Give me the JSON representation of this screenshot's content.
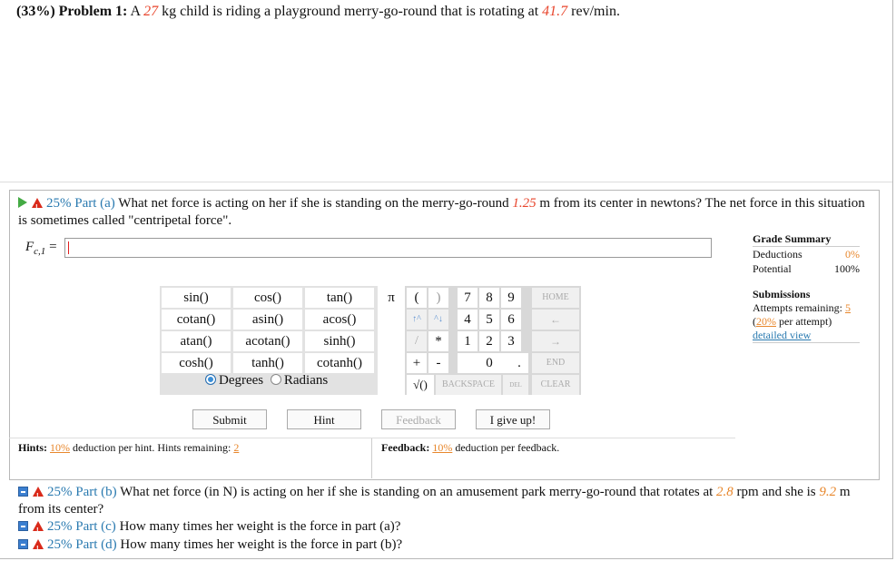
{
  "problem": {
    "prefix": "(33%) Problem 1:",
    "t1": "A",
    "mass": "27",
    "t2": "kg child is riding a playground merry-go-round that is rotating at",
    "rate": "41.7",
    "t3": "rev/min."
  },
  "part_a": {
    "label": "25% Part (a)",
    "t1": "What net force is acting on her if she is standing on the merry-go-round",
    "dist": "1.25",
    "t2": "m from its center in newtons? The net force in",
    "t3": "this situation is sometimes called \"centripetal force\"."
  },
  "answer": {
    "var": "F",
    "sub": "c,1",
    "eq": "=",
    "value": ""
  },
  "grade": {
    "title": "Grade Summary",
    "deductions_label": "Deductions",
    "deductions_value": "0%",
    "potential_label": "Potential",
    "potential_value": "100%"
  },
  "submissions": {
    "title": "Submissions",
    "attempts_label": "Attempts remaining:",
    "attempts_value": "5",
    "per_open": "(",
    "per_value": "20%",
    "per_text": "per attempt)",
    "detailed": "detailed view"
  },
  "functions": [
    "sin()",
    "cos()",
    "tan()",
    "cotan()",
    "asin()",
    "acos()",
    "atan()",
    "acotan()",
    "sinh()",
    "cosh()",
    "tanh()",
    "cotanh()"
  ],
  "angle": {
    "degrees": "Degrees",
    "radians": "Radians"
  },
  "keypad": {
    "pi": "π",
    "lparen": "(",
    "rparen": ")",
    "k7": "7",
    "k8": "8",
    "k9": "9",
    "home": "HOME",
    "up": "↑^",
    "upd": "^↓",
    "k4": "4",
    "k5": "5",
    "k6": "6",
    "left": "←",
    "div": "/",
    "mul": "*",
    "k1": "1",
    "k2": "2",
    "k3": "3",
    "right": "→",
    "plus": "+",
    "minus": "-",
    "k0": "0",
    "dot": ".",
    "end": "END",
    "sqrt": "√()",
    "backspace": "BACKSPACE",
    "del": "DEL",
    "clear": "CLEAR"
  },
  "buttons": {
    "submit": "Submit",
    "hint": "Hint",
    "feedback": "Feedback",
    "giveup": "I give up!"
  },
  "hints": {
    "label": "Hints:",
    "pct": "10%",
    "t1": "deduction per hint. Hints remaining:",
    "remaining": "2"
  },
  "feedback": {
    "label": "Feedback:",
    "pct": "10%",
    "t1": "deduction per feedback."
  },
  "part_b": {
    "label": "25% Part (b)",
    "t1": "What net force (in N) is acting on her if she is standing on an amusement park merry-go-round that rotates at",
    "rpm": "2.8",
    "t2": "rpm and",
    "t3": "she is",
    "dist": "9.2",
    "t4": "m from its center?"
  },
  "part_c": {
    "label": "25% Part (c)",
    "text": "How many times her weight is the force in part (a)?"
  },
  "part_d": {
    "label": "25% Part (d)",
    "text": "How many times her weight is the force in part (b)?"
  },
  "colors": {
    "accent_red": "#e8452c",
    "accent_orange": "#e8872c",
    "link_blue": "#2a7ab0",
    "warn_red": "#d92a1a"
  }
}
